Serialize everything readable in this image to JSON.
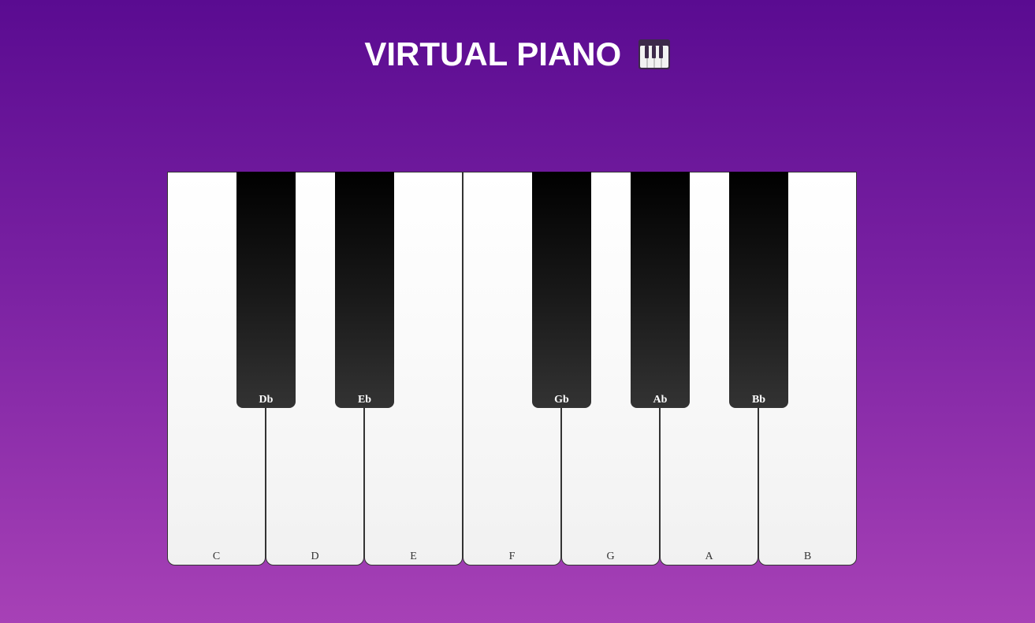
{
  "header": {
    "title": "VIRTUAL PIANO"
  },
  "piano": {
    "white_keys": [
      {
        "label": "C"
      },
      {
        "label": "D"
      },
      {
        "label": "E"
      },
      {
        "label": "F"
      },
      {
        "label": "G"
      },
      {
        "label": "A"
      },
      {
        "label": "B"
      }
    ],
    "black_keys": [
      {
        "label": "Db"
      },
      {
        "label": "Eb"
      },
      {
        "label": "Gb"
      },
      {
        "label": "Ab"
      },
      {
        "label": "Bb"
      }
    ]
  },
  "colors": {
    "background_top": "#5a0b91",
    "background_bottom": "#a741b6",
    "title": "#ffffff",
    "white_key": "#ffffff",
    "black_key": "#000000",
    "key_border": "#333333"
  },
  "icons": {
    "title_icon": "musical-keyboard-icon"
  }
}
